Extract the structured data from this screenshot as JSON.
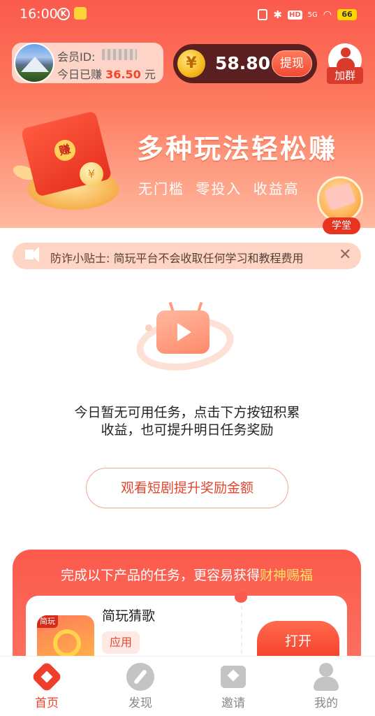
{
  "status_bar": {
    "time": "16:00",
    "k_badge": "K",
    "battery": "66",
    "hd": "HD",
    "signal": "5G"
  },
  "member": {
    "id_label": "会员ID:",
    "today_label": "今日已赚",
    "today_amount": "36.50",
    "today_unit": "元"
  },
  "balance": {
    "coin_symbol": "¥",
    "amount": "58.80",
    "withdraw_label": "提现"
  },
  "join_group": {
    "label": "加群"
  },
  "banner": {
    "seal_text": "赚",
    "coin_symbol": "¥",
    "title": "多种玩法轻松赚",
    "subtitle": "无门槛 零投入 收益高"
  },
  "study_hall": {
    "label": "学堂"
  },
  "notice": {
    "text": "防诈小贴士: 简玩平台不会收取任何学习和教程费用",
    "close": "✕"
  },
  "empty_state": {
    "message": "今日暂无可用任务，点击下方按钮积累收益，也可提升明日任务奖励",
    "button_label": "观看短剧提升奖励金额"
  },
  "products": {
    "heading_prefix": "完成以下产品的任务，更容易获得",
    "heading_highlight": "财神赐福",
    "items": [
      {
        "icon_tag": "简玩",
        "name": "简玩猜歌",
        "badge": "应用",
        "action_label": "打开"
      }
    ]
  },
  "bottom_nav": {
    "items": [
      {
        "label": "首页",
        "icon": "home-icon",
        "active": true
      },
      {
        "label": "发现",
        "icon": "discover-icon",
        "active": false
      },
      {
        "label": "邀请",
        "icon": "invite-icon",
        "active": false
      },
      {
        "label": "我的",
        "icon": "profile-icon",
        "active": false
      }
    ]
  },
  "colors": {
    "brand_red": "#fb5a4c",
    "accent_yellow": "#ffe066",
    "balance_bg": "#5a1f1f"
  }
}
